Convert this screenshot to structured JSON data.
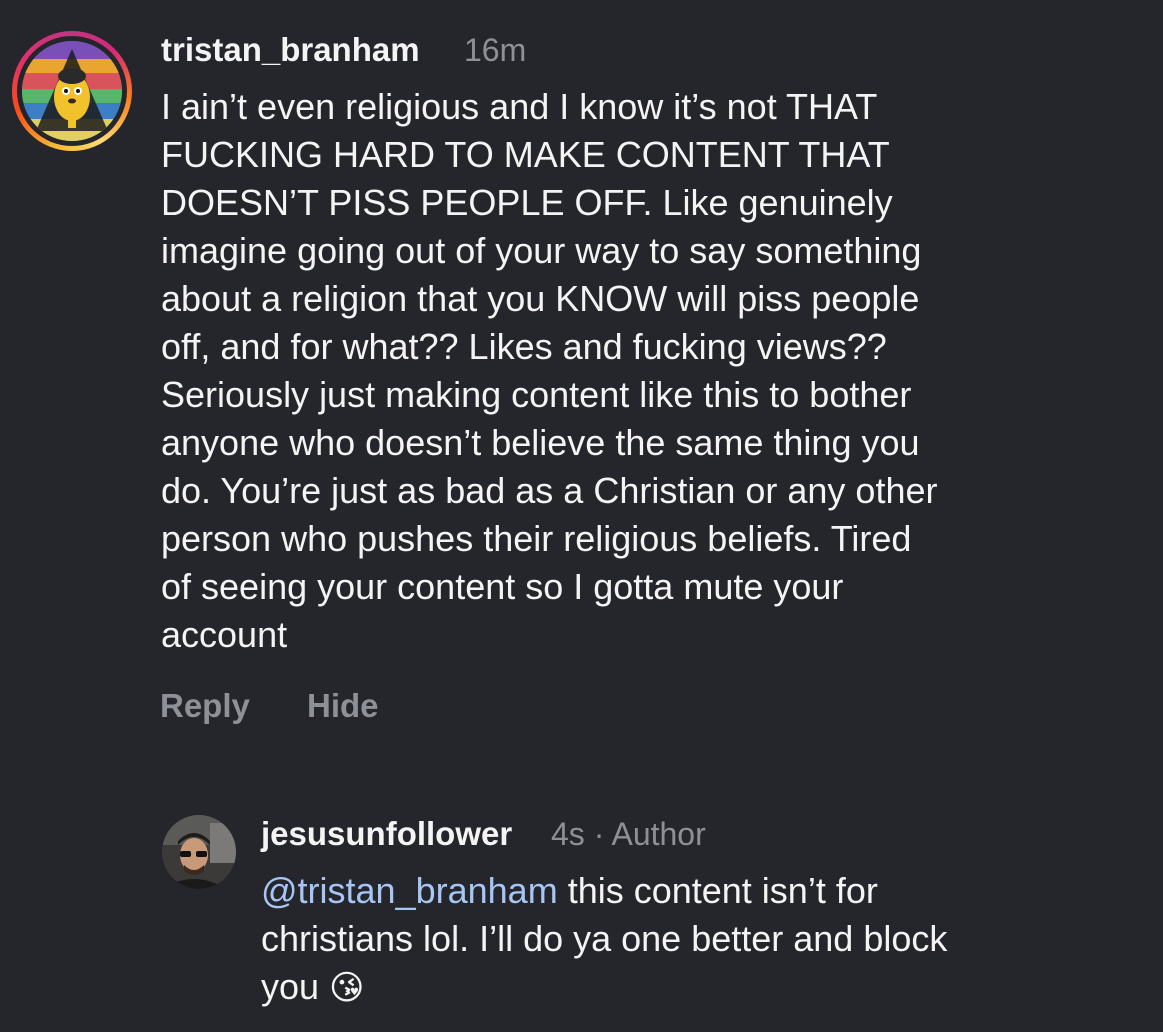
{
  "comment_main": {
    "username": "tristan_branham",
    "time": "16m",
    "text_lines": [
      "I ain’t even religious and I know it’s not THAT",
      "FUCKING HARD TO MAKE CONTENT THAT",
      "DOESN’T PISS PEOPLE OFF.  Like genuinely",
      "imagine going out of your way to say something",
      "about a religion that you KNOW will piss people",
      "off, and for what?? Likes and fucking views??",
      "Seriously just making content like this to bother",
      "anyone who doesn’t believe the same thing you",
      "do.  You’re just as bad as a Christian or any other",
      "person who pushes their religious beliefs.  Tired",
      "of seeing your content so I gotta mute your",
      "account"
    ],
    "actions": {
      "reply": "Reply",
      "hide": "Hide"
    }
  },
  "comment_reply": {
    "username": "jesusunfollower",
    "time": "4s",
    "separator": "·",
    "role": "Author",
    "mention": "@tristan_branham",
    "text_line1_rest": " this content isn’t for",
    "text_line2": "christians lol. I’ll do ya one better and block",
    "text_line3": "you ",
    "emoji": "😘"
  },
  "colors": {
    "background": "#25262b",
    "text": "#f4f4f5",
    "muted": "#8e9097",
    "mention": "#a7c6f5"
  },
  "icons": {
    "avatar_main": "cartoon-dog-avatar-icon",
    "avatar_reply": "person-photo-avatar-icon",
    "emoji": "face-blowing-kiss-emoji"
  }
}
